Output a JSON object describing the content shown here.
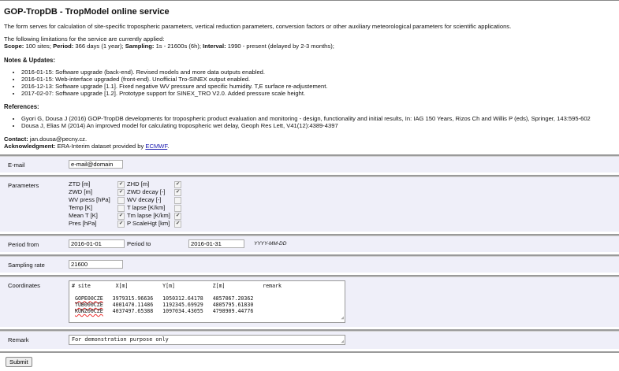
{
  "title": "GOP-TropDB - TropModel online service",
  "description": "The form serves for calculation of site-specific tropospheric parameters, vertical reduction parameters, conversion factors or other auxiliary meteorological parameters for scientific applications.",
  "limitations": {
    "intro": "The following limitations for the service are currently applied:",
    "scope_label": "Scope:",
    "scope": "100 sites;",
    "period_label": "Period:",
    "period": "366 days (1 year);",
    "sampling_label": "Sampling:",
    "sampling": "1s - 21600s (6h);",
    "interval_label": "Interval:",
    "interval": "1990 - present (delayed by 2-3 months);"
  },
  "notes": {
    "heading": "Notes & Updates:",
    "items": [
      "2016-01-15: Software upgrade (back-end). Revised models and more data outputs enabled.",
      "2016-01-15: Web-interface upgraded (front-end). Unofficial Tro-SINEX output enabled.",
      "2016-12-13: Software upgrade [1.1]. Fixed negative WV pressure and specific humidity. T,E surface re-adjustement.",
      "2017-02-07: Software upgrade [1.2]. Prototype support for SINEX_TRO V2.0. Added pressure scale height."
    ]
  },
  "references": {
    "heading": "References:",
    "items": [
      "Gyori G, Dousa J (2016) GOP-TropDB developments for tropospheric product evaluation and monitoring - design, functionality and initial results, In: IAG 150 Years, Rizos Ch and Willis P (eds), Springer, 143:595-602",
      "Dousa J, Elias M (2014) An improved model for calculating tropospheric wet delay, Geoph Res Lett, V41(12):4389-4397"
    ]
  },
  "contact": {
    "label": "Contact:",
    "value": "jan.dousa@pecny.cz."
  },
  "ack": {
    "label": "Acknowledgment:",
    "text": "ERA-Interim dataset provided by",
    "link": "ECMWF",
    "suffix": "."
  },
  "form": {
    "email": {
      "label": "E-mail",
      "value": "e-mail@domain"
    },
    "parameters": {
      "label": "Parameters",
      "left": [
        {
          "name": "ZTD [m]",
          "checked": true
        },
        {
          "name": "ZWD [m]",
          "checked": true
        },
        {
          "name": "WV press [hPa]",
          "checked": false
        },
        {
          "name": "Temp [K]",
          "checked": false
        },
        {
          "name": "Mean T [K]",
          "checked": true
        },
        {
          "name": "Pres [hPa]",
          "checked": true
        }
      ],
      "right": [
        {
          "name": "ZHD [m]",
          "checked": true
        },
        {
          "name": "ZWD decay [-]",
          "checked": true
        },
        {
          "name": "WV decay [-]",
          "checked": false
        },
        {
          "name": "T lapse [K/km]",
          "checked": false
        },
        {
          "name": "Tm lapse [K/km]",
          "checked": true
        },
        {
          "name": "P ScaleHgt [km]",
          "checked": true
        }
      ]
    },
    "period": {
      "from_label": "Period from",
      "from": "2016-01-01",
      "to_label": "Period to",
      "to": "2016-01-31",
      "format": "YYYY-MM-DD"
    },
    "sampling": {
      "label": "Sampling rate",
      "value": "21600"
    },
    "coordinates": {
      "label": "Coordinates",
      "header": "# site        X[m]           Y[m]            Z[m]            remark",
      "rows": [
        {
          "site": "GOPE00CZE",
          "x": "3979315.96636",
          "y": "1050312.64178",
          "z": "4857067.20362"
        },
        {
          "site": "TUB000CZE",
          "x": "4001470.11486",
          "y": "1192345.69929",
          "z": "4805795.61830"
        },
        {
          "site": "KUNZ00CZE",
          "x": "4037497.65388",
          "y": "1097034.43055",
          "z": "4798909.44776"
        }
      ]
    },
    "remark": {
      "label": "Remark",
      "value": "For demonstration purpose only"
    },
    "submit": "Submit"
  }
}
